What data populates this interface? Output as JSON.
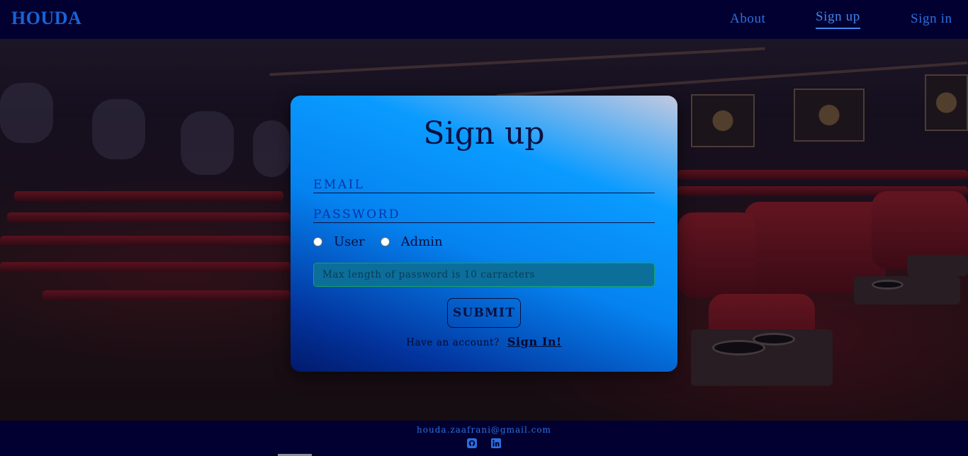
{
  "nav": {
    "brand": "HOUDA",
    "links": [
      "About",
      "Sign up",
      "Sign in"
    ],
    "active": "Sign up"
  },
  "form": {
    "title": "Sign up",
    "email_placeholder": "EMAIL",
    "password_placeholder": "PASSWORD",
    "roles": [
      "User",
      "Admin"
    ],
    "hint": "Max length of password is 10 carracters",
    "submit_label": "SUBMIT",
    "have_account_text": "Have an account?",
    "signin_link": "Sign In!"
  },
  "footer": {
    "email": "houda.zaafrani@gmail.com",
    "icons": [
      "github-icon",
      "linkedin-icon"
    ]
  },
  "colors": {
    "nav_bg": "#020030",
    "accent": "#2c6fe0",
    "card_dark": "#0a1042"
  }
}
